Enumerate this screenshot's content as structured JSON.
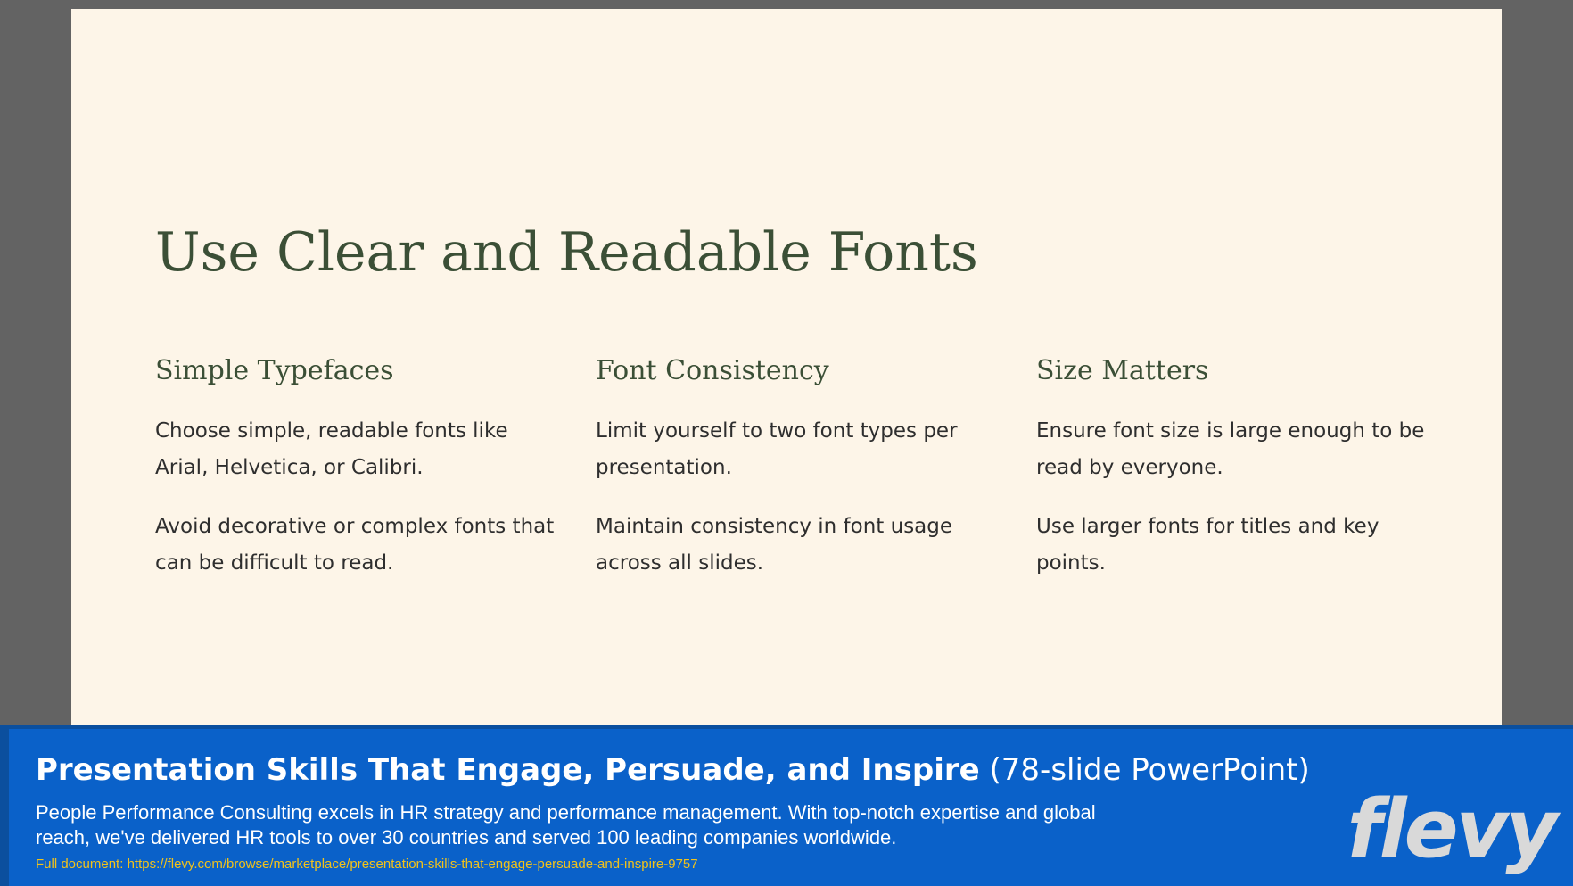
{
  "slide": {
    "title": "Use Clear and Readable Fonts",
    "columns": [
      {
        "heading": "Simple Typefaces",
        "paragraphs": [
          "Choose simple, readable fonts like Arial, Helvetica, or Calibri.",
          "Avoid decorative or complex fonts that can be difficult to read."
        ]
      },
      {
        "heading": "Font Consistency",
        "paragraphs": [
          "Limit yourself to two font types per presentation.",
          "Maintain consistency in font usage across all slides."
        ]
      },
      {
        "heading": "Size Matters",
        "paragraphs": [
          "Ensure font size is large enough to be read by everyone.",
          "Use larger fonts for titles and key points."
        ]
      }
    ]
  },
  "banner": {
    "title_bold": "Presentation Skills That Engage, Persuade, and Inspire",
    "title_suffix": "(78-slide PowerPoint)",
    "description": "People Performance Consulting excels in HR strategy and performance management. With top-notch expertise and global reach, we've delivered HR tools to over 30 countries and served 100 leading companies worldwide.",
    "link_label": "Full document:",
    "link_url": "https://flevy.com/browse/marketplace/presentation-skills-that-engage-persuade-and-inspire-9757",
    "logo_text": "flevy"
  },
  "colors": {
    "background": "#636363",
    "slide_bg": "#fdf5e8",
    "heading": "#3b4f36",
    "banner_bg": "#0a61c9",
    "link": "#f2c21a"
  }
}
